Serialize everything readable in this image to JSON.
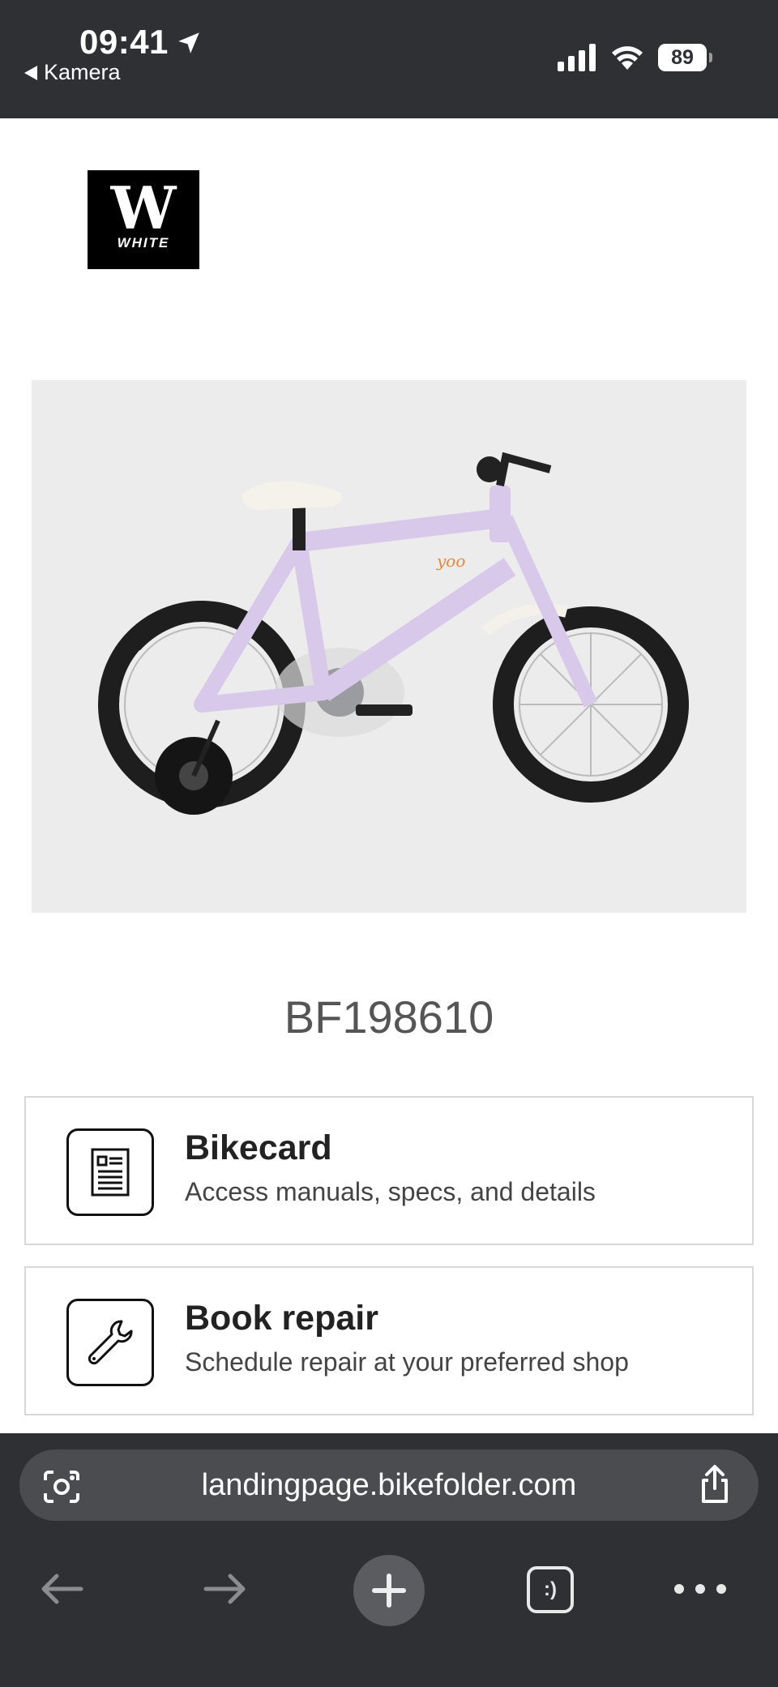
{
  "status_bar": {
    "time": "09:41",
    "back_app": "Kamera",
    "battery": "89"
  },
  "brand": {
    "logo_letter": "W",
    "logo_text": "WHITE"
  },
  "product": {
    "serial": "BF198610",
    "frame_color": "#d8c8ea"
  },
  "cards": [
    {
      "title": "Bikecard",
      "description": "Access manuals, specs, and details",
      "icon": "document-icon"
    },
    {
      "title": "Book repair",
      "description": "Schedule repair at your preferred shop",
      "icon": "wrench-icon"
    }
  ],
  "browser": {
    "url": "landingpage.bikefolder.com",
    "tabs_label": ":)"
  }
}
